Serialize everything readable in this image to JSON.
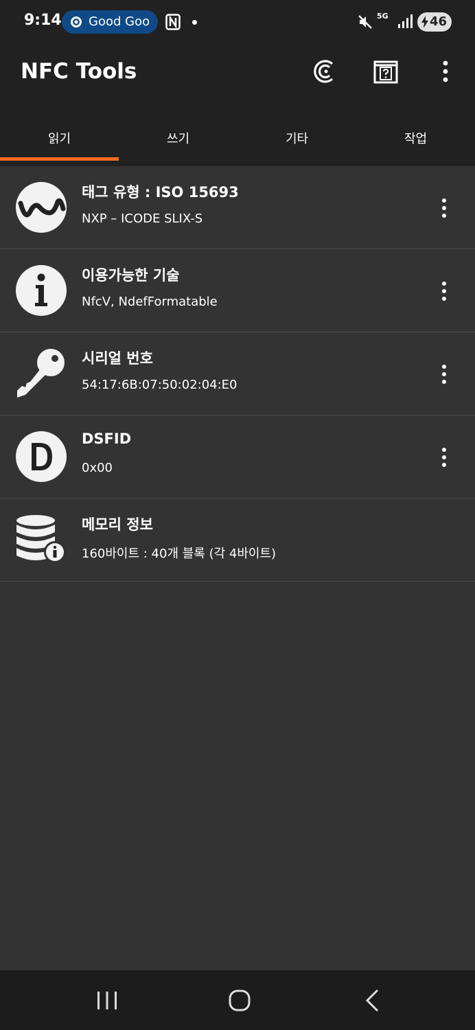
{
  "status_bar": {
    "time": "9:14",
    "notification_pill": "Good Goo",
    "network_label": "5G",
    "battery": "46"
  },
  "app_bar": {
    "title": "NFC Tools"
  },
  "tabs": [
    {
      "label": "읽기",
      "selected": true
    },
    {
      "label": "쓰기",
      "selected": false
    },
    {
      "label": "기타",
      "selected": false
    },
    {
      "label": "작업",
      "selected": false
    }
  ],
  "colors": {
    "accent": "#f36b21",
    "app_bar_bg": "#212121",
    "content_bg": "#333333"
  },
  "records": [
    {
      "icon": "waveform-icon",
      "title": "태그 유형 : ISO 15693",
      "subtitle": "NXP – ICODE SLIX-S"
    },
    {
      "icon": "info-icon",
      "title": "이용가능한 기술",
      "subtitle": "NfcV, NdefFormatable"
    },
    {
      "icon": "key-icon",
      "title": "시리얼 번호",
      "subtitle": "54:17:6B:07:50:02:04:E0"
    },
    {
      "icon": "letter-d-icon",
      "title": "DSFID",
      "subtitle": "0x00"
    },
    {
      "icon": "database-info-icon",
      "title": "메모리 정보",
      "subtitle": "160바이트 : 40개 블록 (각 4바이트)"
    }
  ],
  "nav_bar": {
    "buttons": [
      "recent-apps",
      "home",
      "back"
    ]
  }
}
